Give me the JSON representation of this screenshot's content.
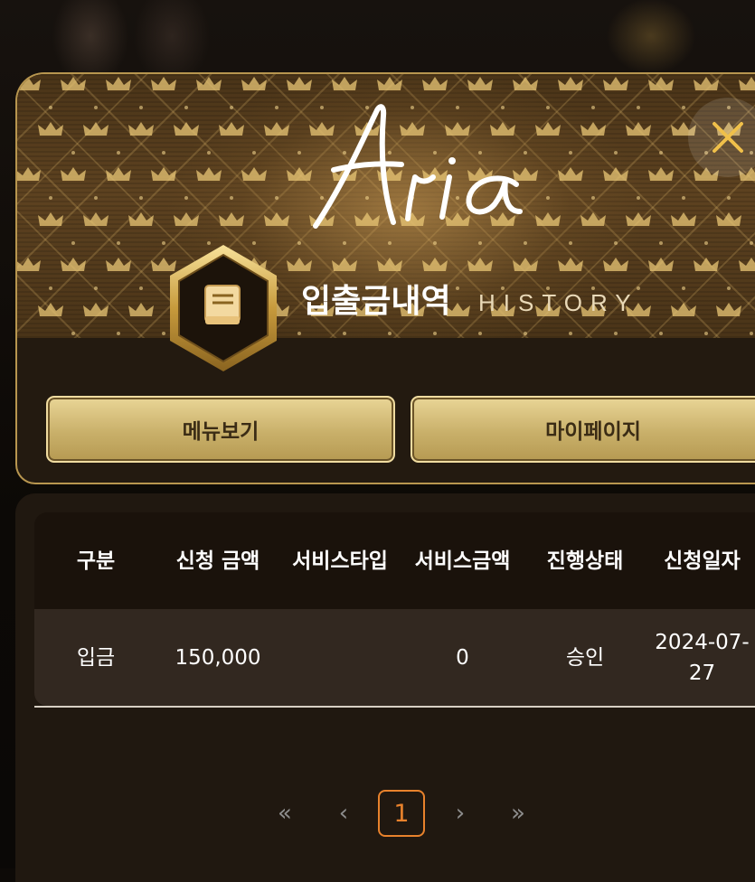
{
  "header": {
    "logo_text": "Aria",
    "title_ko": "입출금내역",
    "title_en": "HISTORY",
    "close_icon": "close-icon",
    "book_icon": "book-icon"
  },
  "buttons": {
    "menu": "메뉴보기",
    "mypage": "마이페이지"
  },
  "table": {
    "headers": [
      "구분",
      "신청 금액",
      "서비스타입",
      "서비스금액",
      "진행상태",
      "신청일자"
    ],
    "rows": [
      [
        "입금",
        "150,000",
        "",
        "0",
        "승인",
        "2024-07-27"
      ]
    ]
  },
  "pagination": {
    "first": "«",
    "prev": "‹",
    "current": "1",
    "next": "›",
    "last": "»"
  },
  "colors": {
    "gold": "#c9b06a",
    "accent_orange": "#e8822c",
    "panel": "#201810"
  }
}
